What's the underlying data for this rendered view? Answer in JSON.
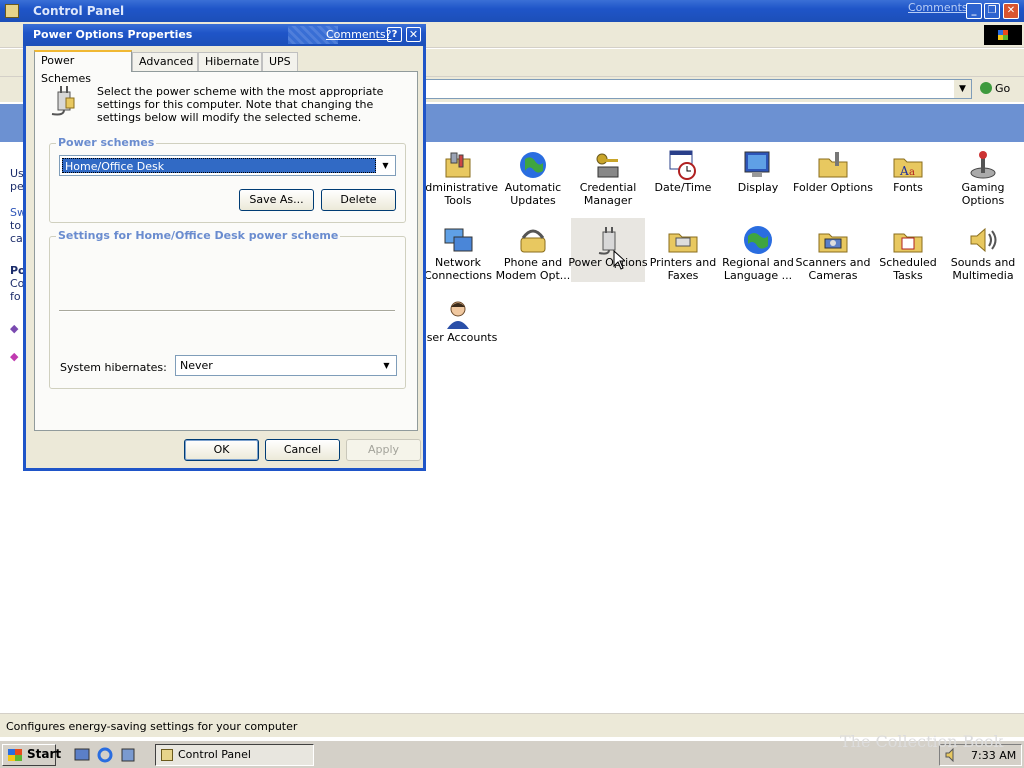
{
  "window": {
    "title": "Control Panel",
    "comments_link": "Comments?",
    "minimize": "_",
    "restore": "❐",
    "close": "✕"
  },
  "address": {
    "go_label": "Go"
  },
  "left_pane": [
    "Us",
    "pe",
    "Sw",
    "to",
    "ca",
    "Po",
    "Co",
    "fo"
  ],
  "icons": [
    {
      "label": "Administrative Tools"
    },
    {
      "label": "Automatic Updates"
    },
    {
      "label": "Credential Manager"
    },
    {
      "label": "Date/Time"
    },
    {
      "label": "Display"
    },
    {
      "label": "Folder Options"
    },
    {
      "label": "Fonts"
    },
    {
      "label": "Gaming Options"
    },
    {
      "label": "Network Connections"
    },
    {
      "label": "Phone and Modem Opt..."
    },
    {
      "label": "Power Options"
    },
    {
      "label": "Printers and Faxes"
    },
    {
      "label": "Regional and Language ..."
    },
    {
      "label": "Scanners and Cameras"
    },
    {
      "label": "Scheduled Tasks"
    },
    {
      "label": "Sounds and Multimedia"
    },
    {
      "label": "User Accounts"
    }
  ],
  "statusbar": {
    "text": "Configures energy-saving settings for your computer"
  },
  "taskbar": {
    "start_label": "Start",
    "task_label": "Control Panel",
    "clock": "7:33 AM"
  },
  "watermark": "The Collection Book",
  "dialog": {
    "title": "Power Options Properties",
    "comments_link": "Comments?",
    "help": "?",
    "close": "✕",
    "tabs": [
      {
        "label": "Power Schemes",
        "active": true
      },
      {
        "label": "Advanced"
      },
      {
        "label": "Hibernate"
      },
      {
        "label": "UPS"
      }
    ],
    "intro": "Select the power scheme with the most appropriate settings for this computer. Note that changing the settings below will modify the selected scheme.",
    "schemes_group": "Power schemes",
    "scheme_value": "Home/Office Desk",
    "save_as": "Save As...",
    "delete": "Delete",
    "settings_group": "Settings for Home/Office Desk power scheme",
    "hibernate_label": "System hibernates:",
    "hibernate_value": "Never",
    "ok": "OK",
    "cancel": "Cancel",
    "apply": "Apply"
  }
}
